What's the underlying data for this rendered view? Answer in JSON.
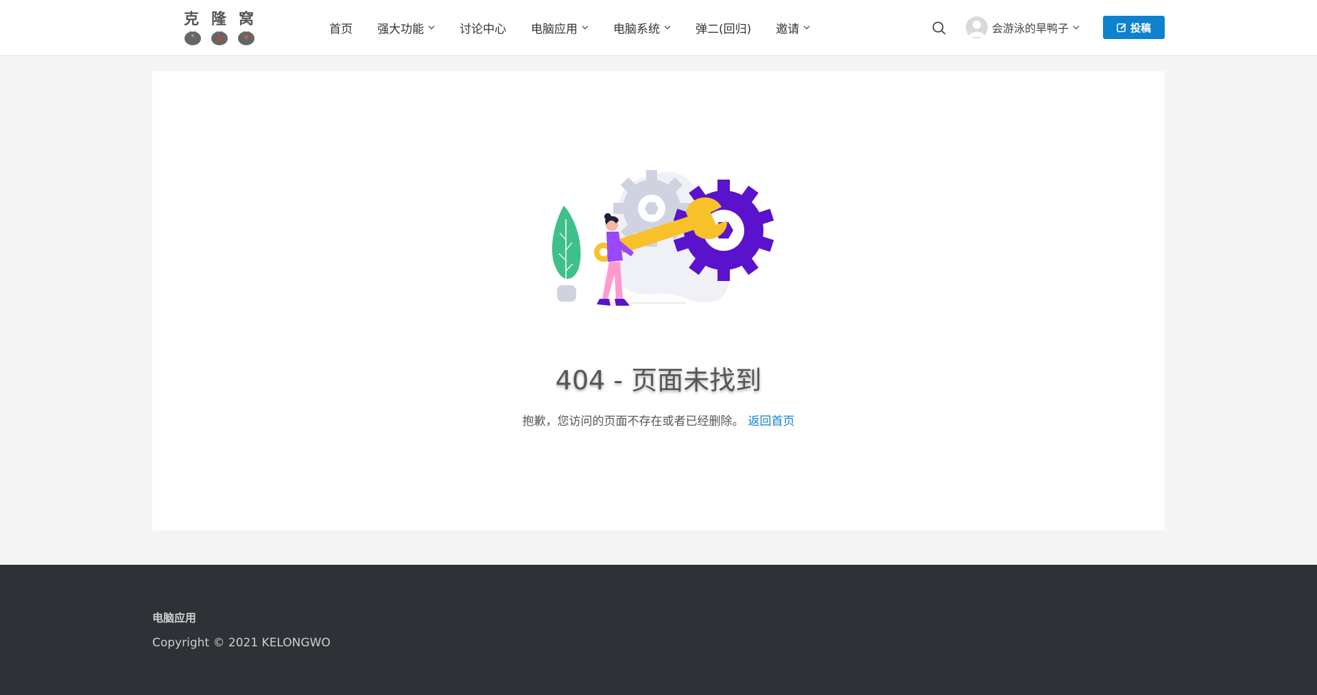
{
  "logo": {
    "text": [
      "克",
      "隆",
      "窝"
    ]
  },
  "nav": {
    "items": [
      {
        "label": "首页",
        "dropdown": false
      },
      {
        "label": "强大功能",
        "dropdown": true
      },
      {
        "label": "讨论中心",
        "dropdown": false
      },
      {
        "label": "电脑应用",
        "dropdown": true
      },
      {
        "label": "电脑系统",
        "dropdown": true
      },
      {
        "label": "弹二(回归)",
        "dropdown": false
      },
      {
        "label": "邀请",
        "dropdown": true
      }
    ]
  },
  "user": {
    "name": "会游泳的旱鸭子"
  },
  "submit": {
    "label": "投稿"
  },
  "error": {
    "title": "404 - 页面未找到",
    "message": "抱歉，您访问的页面不存在或者已经删除。",
    "link": "返回首页"
  },
  "footer": {
    "title": "电脑应用",
    "copyright": "Copyright © 2021 KELONGWO"
  },
  "colors": {
    "accent": "#0e82cc",
    "footer_bg": "#2e3135",
    "gear_purple": "#5a12cc",
    "wrench_yellow": "#f7c12a"
  }
}
